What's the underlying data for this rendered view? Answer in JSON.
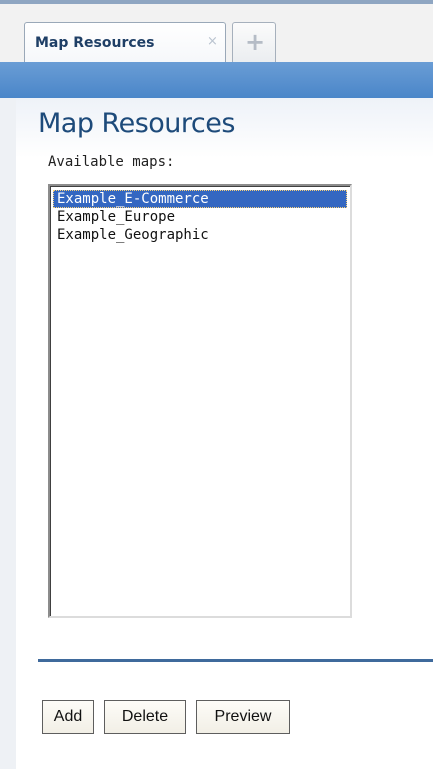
{
  "tabs": {
    "active_label": "Map Resources",
    "close_glyph": "×",
    "add_glyph": "+"
  },
  "page": {
    "title": "Map Resources",
    "available_label": "Available maps:"
  },
  "maps": {
    "items": [
      "Example_E-Commerce",
      "Example_Europe",
      "Example_Geographic"
    ],
    "selected": "Example_E-Commerce"
  },
  "buttons": {
    "add": "Add",
    "delete": "Delete",
    "preview": "Preview"
  },
  "colors": {
    "selection": "#3467c1",
    "title": "#1d4a7a",
    "band": "#4a86c9"
  }
}
